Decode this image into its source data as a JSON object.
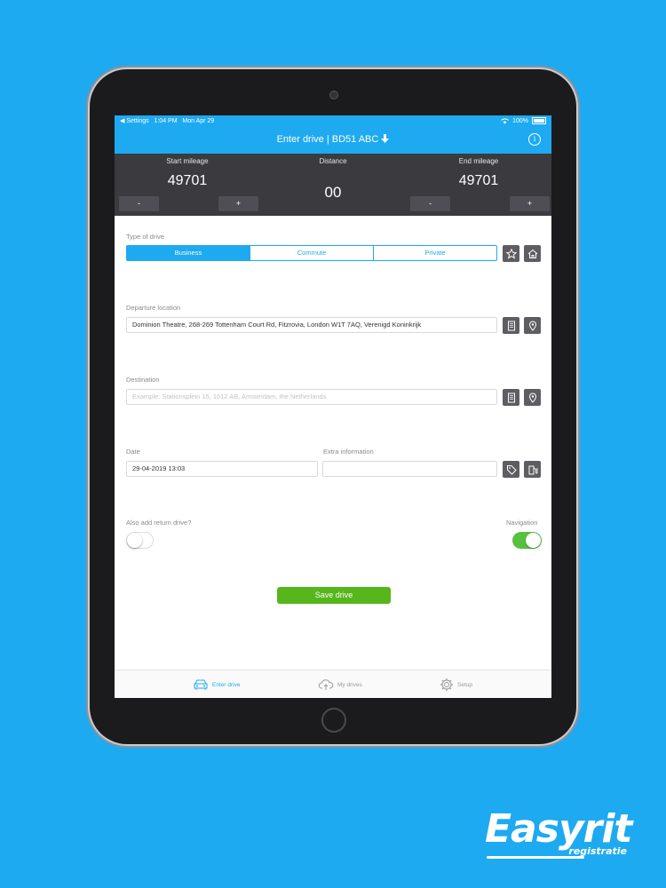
{
  "status_bar": {
    "back_label": "◀ Settings",
    "time": "1:04 PM",
    "date": "Mon Apr 29",
    "battery": "100%"
  },
  "nav": {
    "title": "Enter drive | BD51 ABC",
    "info_icon": "info-icon"
  },
  "mileage": {
    "start_label": "Start mileage",
    "start_value": "49701",
    "distance_label": "Distance",
    "distance_value": "00",
    "end_label": "End mileage",
    "end_value": "49701",
    "minus": "-",
    "plus": "+"
  },
  "type_of_drive": {
    "label": "Type of drive",
    "options": [
      "Business",
      "Commute",
      "Private"
    ],
    "selected": "Business"
  },
  "departure": {
    "label": "Departure location",
    "value": "Dominion Theatre, 268-269 Tottenham Court Rd, Fitzrovia, London W1T 7AQ, Verenigd Koninkrijk"
  },
  "destination": {
    "label": "Destination",
    "placeholder": "Example: Stationsplein 15, 1012 AB, Amsterdam, the Netherlands"
  },
  "date": {
    "label": "Date",
    "value": "29-04-2019 13:03"
  },
  "extra": {
    "label": "Extra information",
    "value": ""
  },
  "return_drive": {
    "label": "Also add return drive?",
    "enabled": false
  },
  "navigation": {
    "label": "Navigation",
    "enabled": true
  },
  "save_button": "Save drive",
  "tabs": [
    {
      "label": "Enter drive",
      "icon": "car-icon",
      "active": true
    },
    {
      "label": "My drives",
      "icon": "cloud-upload-icon",
      "active": false
    },
    {
      "label": "Setup",
      "icon": "gear-icon",
      "active": false
    }
  ],
  "logo": {
    "main": "Easyrit",
    "sub": "registratie"
  },
  "colors": {
    "background": "#1eaaf1",
    "accent": "#1eaaf1",
    "save": "#56b61b",
    "toggle_on": "#57c13f",
    "mileage_bar": "#3a3a3f"
  }
}
